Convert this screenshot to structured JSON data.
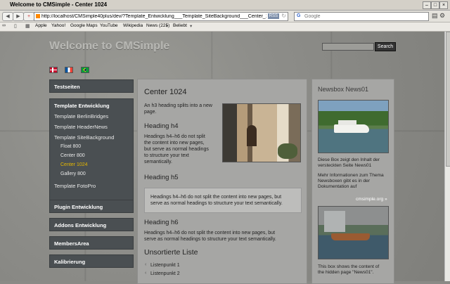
{
  "browser": {
    "window_title": "Welcome to CMSimple - Center 1024",
    "url": "http://localhost/CMSimple40plus/dev/?Template_Entwicklung___Template_SiteBackground___Center_1024",
    "rss_label": "RSS",
    "search_placeholder": "Google",
    "bookmarks": [
      "Apple",
      "Yahoo!",
      "Google Maps",
      "YouTube",
      "Wikipedia",
      "News (225)",
      "Beliebt"
    ]
  },
  "site": {
    "title": "Welcome to CMSimple",
    "search_button": "Search",
    "flags": [
      "Dansk",
      "Français",
      "Português"
    ]
  },
  "menu": {
    "testseiten": "Testseiten",
    "template_entwicklung": "Template Entwicklung",
    "template_berlinbridges": "Template BerlinBridges",
    "template_headernews": "Template HeaderNews",
    "template_sitebackground": "Template SiteBackground",
    "float_800": "Float 800",
    "center_800": "Center 800",
    "center_1024": "Center 1024",
    "gallery_800": "Gallery 800",
    "template_fotopro": "Template FotoPro",
    "plugin_entwicklung": "Plugin Entwicklung",
    "addons_entwicklung": "Addons Entwicklung",
    "membersarea": "MembersArea",
    "kalibrierung": "Kalibrierung"
  },
  "content": {
    "heading": "Center 1024",
    "intro": [
      "An h3 heading splits into a new",
      "page."
    ],
    "h4": "Heading h4",
    "h4_text": [
      "Headings h4–h6 do not split",
      "the content into new pages,",
      "but serve as normal headings",
      "to structure your text",
      "semantically."
    ],
    "h5": "Heading h5",
    "quote_text": [
      "Headings h4–h6 do not split the content into new pages, but",
      "serve as normal headings to structure your text semantically."
    ],
    "h6": "Heading h6",
    "h6_text": [
      "Headings h4–h6 do not split the content into new pages, but",
      "serve as normal headings to structure your text semantically."
    ],
    "list_heading": "Unsortierte Liste",
    "list_items": [
      "Listenpunkt 1",
      "Listenpunkt 2"
    ]
  },
  "newsbox": {
    "title": "Newsbox News01",
    "text1": [
      "Diese Box zeigt den Inhalt der",
      "versteckten Seite News01"
    ],
    "text2": [
      "Mehr Informationen zum Thema",
      "Newsboxen gibt es in der",
      "Dokumentation auf"
    ],
    "link": "cmsimple.org »",
    "text3": [
      "This box shows the content of",
      "the hidden page \"News01\"."
    ]
  }
}
